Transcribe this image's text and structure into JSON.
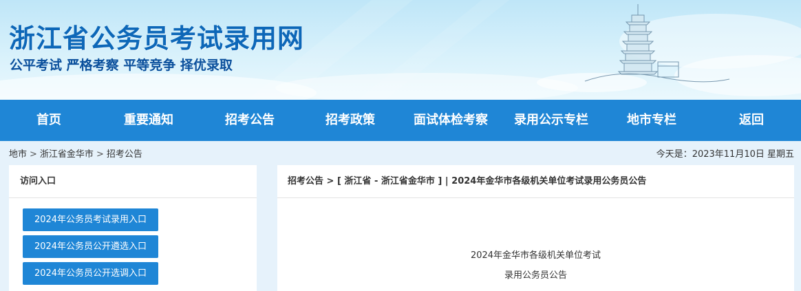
{
  "header": {
    "site_title": "浙江省公务员考试录用网",
    "slogan": "公平考试 严格考察 平等竞争 择优录取"
  },
  "nav": {
    "items": [
      {
        "label": "首页"
      },
      {
        "label": "重要通知"
      },
      {
        "label": "招考公告"
      },
      {
        "label": "招考政策"
      },
      {
        "label": "面试体检考察"
      },
      {
        "label": "录用公示专栏"
      },
      {
        "label": "地市专栏"
      },
      {
        "label": "返回"
      }
    ]
  },
  "breadcrumb": {
    "items": [
      "地市",
      "浙江省金华市",
      "招考公告"
    ],
    "separator": ">"
  },
  "date": {
    "label": "今天是：",
    "value": "2023年11月10日 星期五"
  },
  "sidebar": {
    "title": "访问入口",
    "buttons": [
      {
        "label": "2024年公务员考试录用入口"
      },
      {
        "label": "2024年公务员公开遴选入口"
      },
      {
        "label": "2024年公务员公开选调入口"
      }
    ]
  },
  "article": {
    "path_section": "招考公告",
    "path_region": "[ 浙江省 - 浙江省金华市 ]",
    "path_title": "| 2024年金华市各级机关单位考试录用公务员公告",
    "body_line1": "2024年金华市各级机关单位考试",
    "body_line2": "录用公务员公告"
  },
  "colors": {
    "nav_bg": "#1f86d6",
    "title_blue": "#0d67b8",
    "button_bg": "#1f86d6",
    "page_bg": "#e6f2fb"
  }
}
